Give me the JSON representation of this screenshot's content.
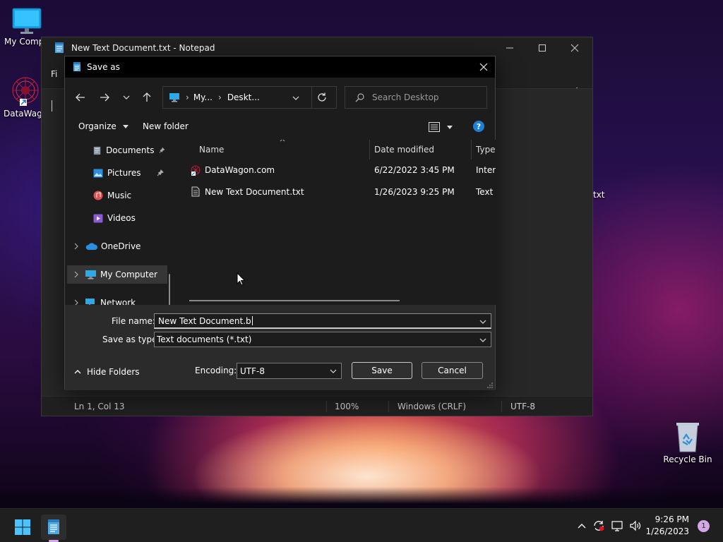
{
  "desktop": {
    "icons": [
      {
        "label": "My Compu",
        "icon": "monitor-icon"
      },
      {
        "label": "DataWago",
        "icon": "datawagon-icon"
      },
      {
        "label": "Recycle Bin",
        "icon": "recycle-bin-icon"
      }
    ],
    "partial_text": "txt"
  },
  "notepad": {
    "title": "New Text Document.txt - Notepad",
    "menu_partial": "Fi",
    "status": {
      "position": "Ln 1, Col 13",
      "zoom": "100%",
      "line_endings": "Windows (CRLF)",
      "encoding": "UTF-8"
    }
  },
  "dialog": {
    "title": "Save as",
    "address": {
      "segments": [
        "My...",
        "Deskt..."
      ]
    },
    "search_placeholder": "Search Desktop",
    "commands": {
      "organize": "Organize",
      "new_folder": "New folder"
    },
    "nav_items": [
      {
        "label": "Documents",
        "icon": "documents-icon",
        "pinned": true
      },
      {
        "label": "Pictures",
        "icon": "pictures-icon",
        "pinned": true
      },
      {
        "label": "Music",
        "icon": "music-icon",
        "pinned": false
      },
      {
        "label": "Videos",
        "icon": "videos-icon",
        "pinned": false
      },
      {
        "label": "OneDrive",
        "icon": "onedrive-icon",
        "expandable": true
      },
      {
        "label": "My Computer",
        "icon": "computer-icon",
        "expandable": true,
        "selected": true
      },
      {
        "label": "Network",
        "icon": "network-icon",
        "expandable": true
      }
    ],
    "columns": {
      "name": "Name",
      "date": "Date modified",
      "type": "Type"
    },
    "files": [
      {
        "name": "DataWagon.com",
        "date": "6/22/2022 3:45 PM",
        "type": "Intern",
        "icon": "internet-shortcut-icon"
      },
      {
        "name": "New Text Document.txt",
        "date": "1/26/2023 9:25 PM",
        "type": "Text D",
        "icon": "text-file-icon"
      }
    ],
    "file_name_label": "File name:",
    "file_name_value": "New Text Document.b",
    "save_type_label": "Save as type:",
    "save_type_value": "Text documents (*.txt)",
    "hide_folders": "Hide Folders",
    "encoding_label": "Encoding:",
    "encoding_value": "UTF-8",
    "save": "Save",
    "cancel": "Cancel"
  },
  "taskbar": {
    "time": "9:26 PM",
    "date": "1/26/2023",
    "notification_count": "1"
  },
  "colors": {
    "accent": "#0078d4",
    "dialog_bg": "#1c1c1c",
    "taskbar_bg": "#1f1f1f"
  }
}
